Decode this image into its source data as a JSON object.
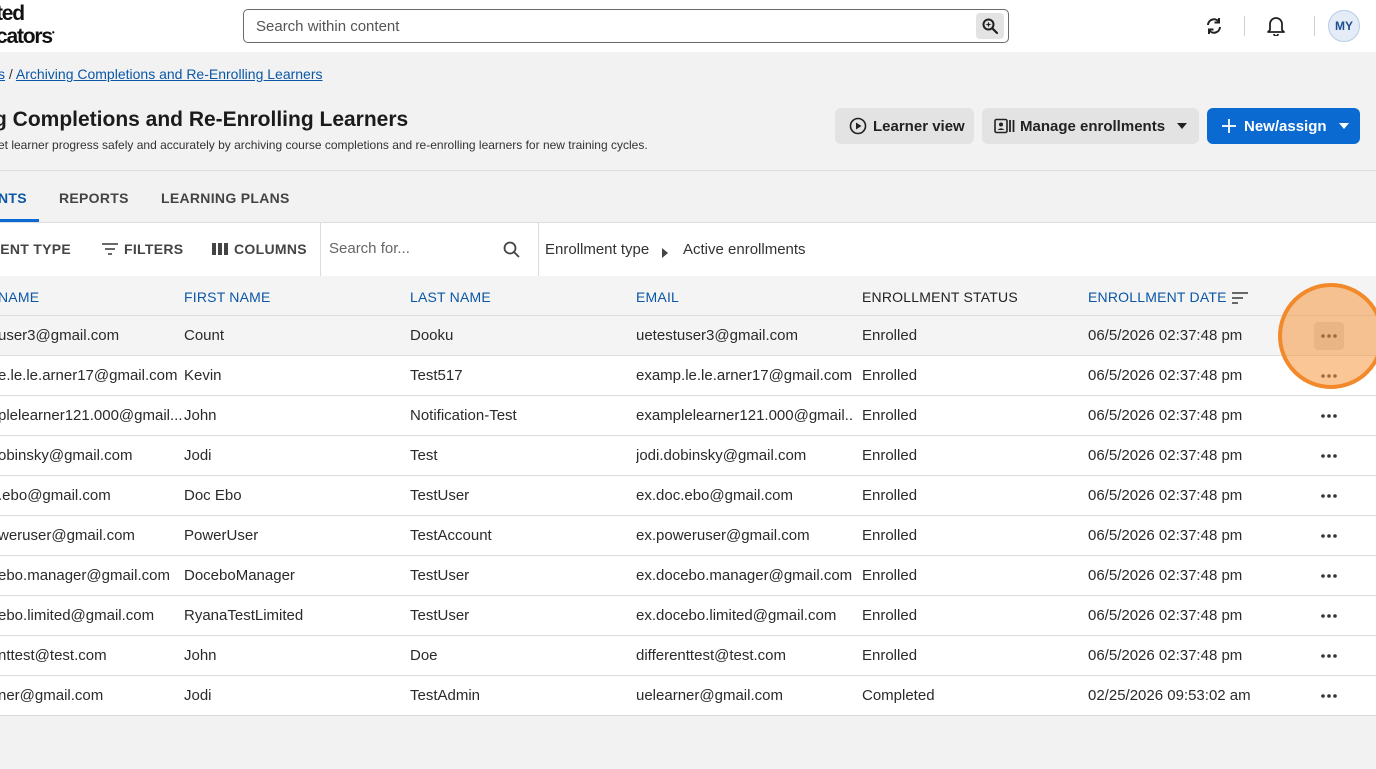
{
  "header": {
    "logo_line1": "ted",
    "logo_line2": "cators",
    "search_placeholder": "Search within content",
    "avatar_initials": "MY"
  },
  "breadcrumb": {
    "prefix": "s",
    "separator": "/",
    "current": "Archiving Completions and Re-Enrolling Learners"
  },
  "page": {
    "title": "g Completions and Re-Enrolling Learners",
    "subtitle": "set learner progress safely and accurately by archiving course completions and re-enrolling learners for new training cycles."
  },
  "actions": {
    "learner_view": "Learner view",
    "manage_enrollments": "Manage enrollments",
    "new_assign": "New/assign"
  },
  "tabs": [
    {
      "label": "NTS",
      "active": true
    },
    {
      "label": "REPORTS",
      "active": false
    },
    {
      "label": "LEARNING PLANS",
      "active": false
    }
  ],
  "toolbar": {
    "enrollment_type": "IENT TYPE",
    "filters": "FILTERS",
    "columns": "COLUMNS",
    "search_placeholder": "Search for...",
    "filter_crumb_1": "Enrollment type",
    "filter_crumb_2": "Active enrollments"
  },
  "table": {
    "columns": [
      "NAME",
      "FIRST NAME",
      "LAST NAME",
      "EMAIL",
      "ENROLLMENT STATUS",
      "ENROLLMENT DATE"
    ],
    "rows": [
      {
        "username": "user3@gmail.com",
        "first": "Count",
        "last": "Dooku",
        "email": "uetestuser3@gmail.com",
        "status": "Enrolled",
        "date": "06/5/2026 02:37:48 pm"
      },
      {
        "username": "e.le.le.arner17@gmail.com",
        "first": "Kevin",
        "last": "Test517",
        "email": "examp.le.le.arner17@gmail.com",
        "status": "Enrolled",
        "date": "06/5/2026 02:37:48 pm"
      },
      {
        "username": "plelearner121.000@gmail....",
        "first": "John",
        "last": "Notification-Test",
        "email": "examplelearner121.000@gmail....",
        "status": "Enrolled",
        "date": "06/5/2026 02:37:48 pm"
      },
      {
        "username": "obinsky@gmail.com",
        "first": "Jodi",
        "last": "Test",
        "email": "jodi.dobinsky@gmail.com",
        "status": "Enrolled",
        "date": "06/5/2026 02:37:48 pm"
      },
      {
        "username": ".ebo@gmail.com",
        "first": "Doc Ebo",
        "last": "TestUser",
        "email": "ex.doc.ebo@gmail.com",
        "status": "Enrolled",
        "date": "06/5/2026 02:37:48 pm"
      },
      {
        "username": "weruser@gmail.com",
        "first": "PowerUser",
        "last": "TestAccount",
        "email": "ex.poweruser@gmail.com",
        "status": "Enrolled",
        "date": "06/5/2026 02:37:48 pm"
      },
      {
        "username": "ebo.manager@gmail.com",
        "first": "DoceboManager",
        "last": "TestUser",
        "email": "ex.docebo.manager@gmail.com",
        "status": "Enrolled",
        "date": "06/5/2026 02:37:48 pm"
      },
      {
        "username": "ebo.limited@gmail.com",
        "first": "RyanaTestLimited",
        "last": "TestUser",
        "email": "ex.docebo.limited@gmail.com",
        "status": "Enrolled",
        "date": "06/5/2026 02:37:48 pm"
      },
      {
        "username": "nttest@test.com",
        "first": "John",
        "last": "Doe",
        "email": "differenttest@test.com",
        "status": "Enrolled",
        "date": "06/5/2026 02:37:48 pm"
      },
      {
        "username": "ner@gmail.com",
        "first": "Jodi",
        "last": "TestAdmin",
        "email": "uelearner@gmail.com",
        "status": "Completed",
        "date": "02/25/2026 09:53:02 am"
      }
    ]
  },
  "colors": {
    "primary": "#0a6ad2",
    "link": "#0b57a6",
    "highlight": "#f28a2b"
  }
}
